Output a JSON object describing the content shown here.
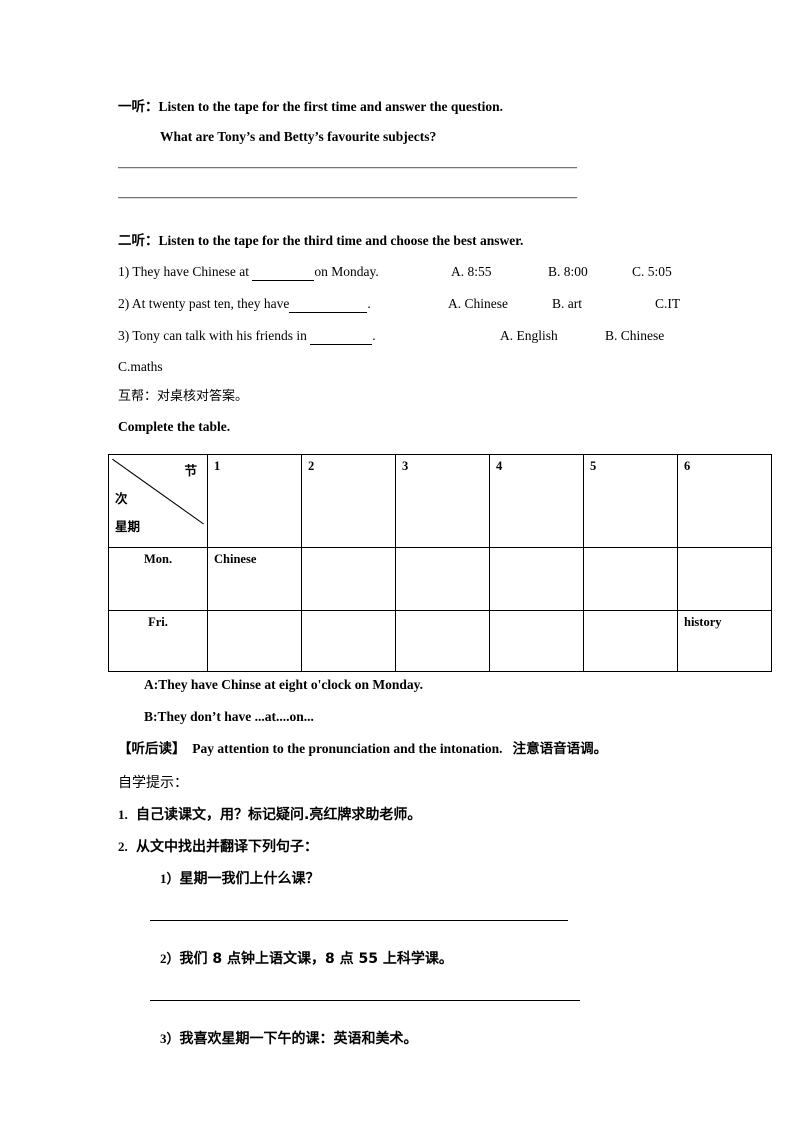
{
  "document": {
    "section_one": {
      "tag": "一听：",
      "instruction": "Listen to the tape for the first time and answer the question.",
      "question": "What are Tony’s and Betty’s favourite subjects?",
      "answer_rule_1": "——————————————————————————————————",
      "answer_rule_2": "——————————————————————————————————"
    },
    "section_two": {
      "tag": "二听：",
      "instruction": "Listen to the tape for the third time and choose the best answer.",
      "questions": [
        {
          "stem_before": "1) They have Chinese at ",
          "stem_after": "on Monday.",
          "options": [
            "A. 8:55",
            "B. 8:00",
            "C. 5:05"
          ]
        },
        {
          "stem_before": "2) At twenty past ten, they have",
          "stem_after": ".",
          "options": [
            "A. Chinese",
            "B. art",
            "C.IT"
          ]
        },
        {
          "stem_before": "3)  Tony  can  talk  with  his  friends  in  ",
          "stem_after": ".",
          "options": [
            "A.  English",
            "B.  Chinese"
          ]
        }
      ],
      "option_overflow": "C.maths",
      "pair_check": "互帮：对桌核对答案。"
    },
    "table_section": {
      "title": "Complete the table.",
      "corner": {
        "top_right": "节",
        "middle_left": "次",
        "bottom_left": "星期"
      },
      "column_headers": [
        "1",
        "2",
        "3",
        "4",
        "5",
        "6"
      ],
      "rows": [
        {
          "day": "Mon.",
          "cells": [
            "Chinese",
            "",
            "",
            "",
            "",
            ""
          ]
        },
        {
          "day": "Fri.",
          "cells": [
            "",
            "",
            "",
            "",
            "",
            "history"
          ]
        }
      ],
      "example_a": "A:They have Chinse at eight o'clock on Monday.",
      "example_b": "B:They don’t have ...at....on..."
    },
    "post_reading": {
      "marker": "【听后读】",
      "english": "Pay attention to the pronunciation and the intonation.",
      "chinese": "注意语音语调。"
    },
    "self_study": {
      "title": "自学提示：",
      "items": [
        {
          "num": "1.",
          "text": "自己读课文，用？标记疑问.亮红牌求助老师。"
        },
        {
          "num": "2.",
          "text": "从文中找出并翻译下列句子："
        }
      ],
      "sub_items": [
        {
          "num": "1）",
          "text": "星期一我们上什么课？"
        },
        {
          "num": "2）",
          "text": "我们 8 点钟上语文课，8 点 55 上科学课。"
        },
        {
          "num": "3）",
          "text": "我喜欢星期一下午的课：英语和美术。"
        }
      ]
    }
  }
}
